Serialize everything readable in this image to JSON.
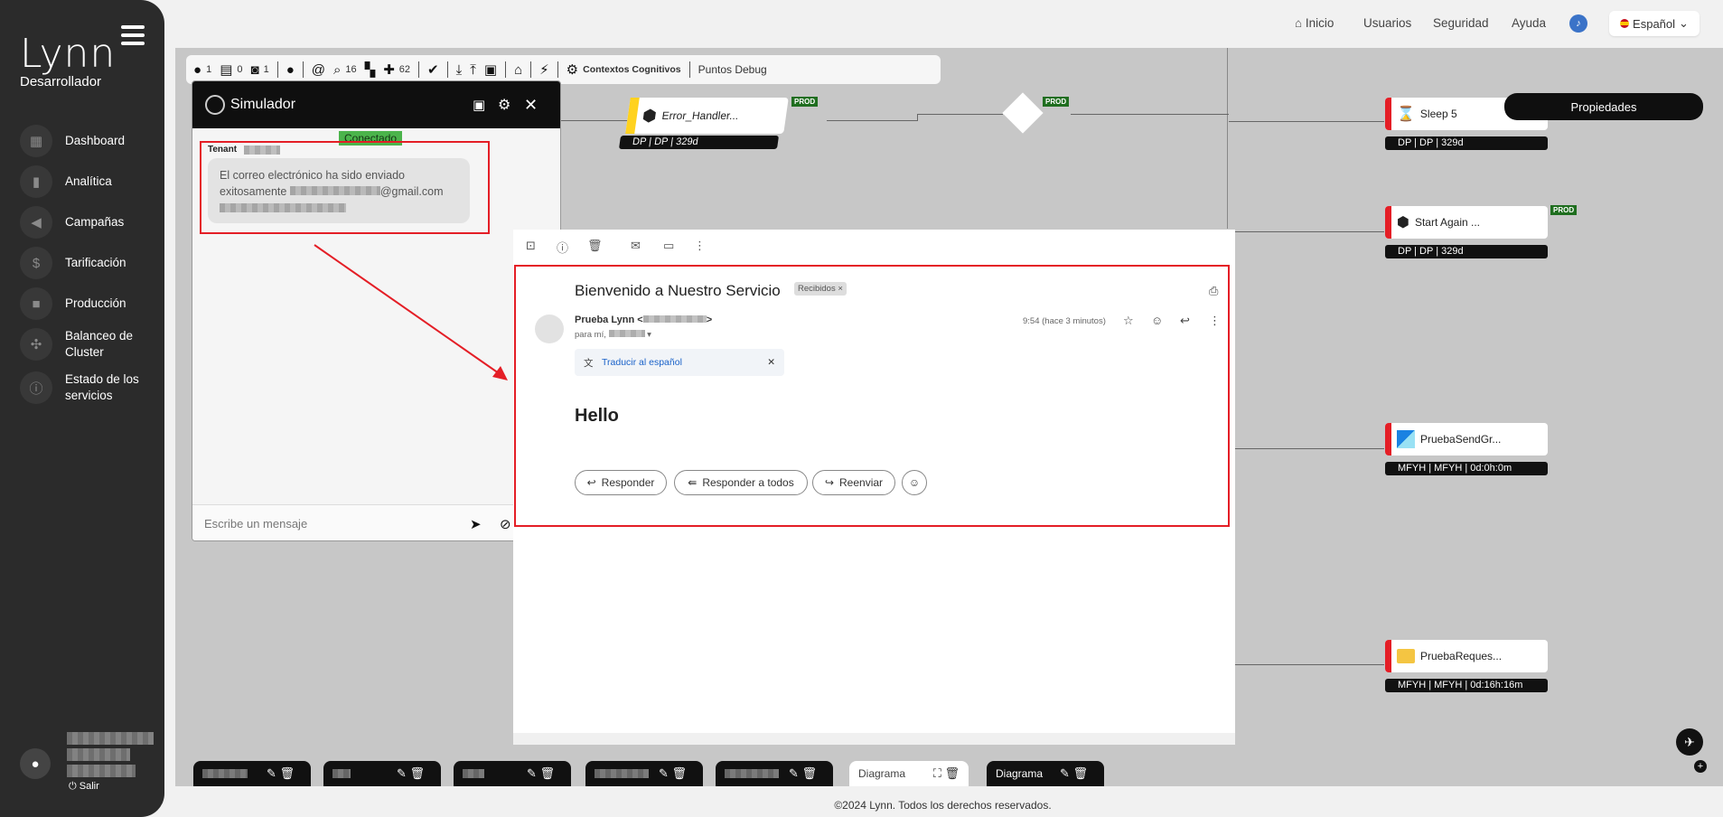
{
  "sidebar": {
    "logo": "Lynn",
    "role": "Desarrollador",
    "items": [
      {
        "label": "Dashboard",
        "icon": "dashboard-icon"
      },
      {
        "label": "Analítica",
        "icon": "bar-chart-icon"
      },
      {
        "label": "Campañas",
        "icon": "megaphone-icon"
      },
      {
        "label": "Tarificación",
        "icon": "dollar-icon"
      },
      {
        "label": "Producción",
        "icon": "briefcase-icon"
      },
      {
        "label": "Balanceo de Cluster",
        "icon": "cluster-icon"
      },
      {
        "label": "Estado de los servicios",
        "icon": "info-icon"
      }
    ],
    "logout": "Salir"
  },
  "topnav": {
    "home": "Inicio",
    "users": "Usuarios",
    "security": "Seguridad",
    "help": "Ayuda",
    "language": "Español"
  },
  "toolbar": {
    "users_count": "1",
    "messages_count": "0",
    "bots_count": "1",
    "search_count": "16",
    "plugins_count": "62",
    "cognitive_contexts": "Contextos Cognitivos",
    "debug_points": "Puntos Debug"
  },
  "nodes": {
    "error_handler": {
      "label": "Error_Handler...",
      "meta": "DP | DP | 329d",
      "badge": "PROD"
    },
    "decision": {
      "badge": "PROD"
    },
    "sleep": {
      "label": "Sleep 5",
      "meta": "DP | DP | 329d"
    },
    "start_again": {
      "label": "Start Again ...",
      "meta": "DP | DP | 329d",
      "badge": "PROD"
    },
    "send_grid": {
      "label": "PruebaSendGr...",
      "meta": "MFYH | MFYH | 0d:0h:0m"
    },
    "request": {
      "label": "PruebaReques...",
      "meta": "MFYH | MFYH | 0d:16h:16m"
    },
    "properties": "Propiedades"
  },
  "simulator": {
    "title": "Simulador",
    "status": "Conectado",
    "tenant": "Tenant",
    "message_line1": "El correo electrónico ha sido enviado",
    "message_line2": "exitosamente",
    "message_domain": "@gmail.com",
    "input_placeholder": "Escribe un mensaje"
  },
  "email": {
    "subject": "Bienvenido a Nuestro Servicio",
    "label": "Recibidos",
    "sender": "Prueba Lynn",
    "to": "para mí,",
    "time": "9:54 (hace 3 minutos)",
    "translate": "Traducir al español",
    "body": "Hello",
    "reply": "Responder",
    "reply_all": "Responder a todos",
    "forward": "Reenviar"
  },
  "bottom_tabs": {
    "diagram1": "Diagrama",
    "diagram2": "Diagrama"
  },
  "footer": "©2024 Lynn. Todos los derechos reservados.",
  "colors": {
    "accent_red": "#e41e26",
    "prod_green": "#1f6e1f",
    "connected_green": "#4bb44b"
  }
}
